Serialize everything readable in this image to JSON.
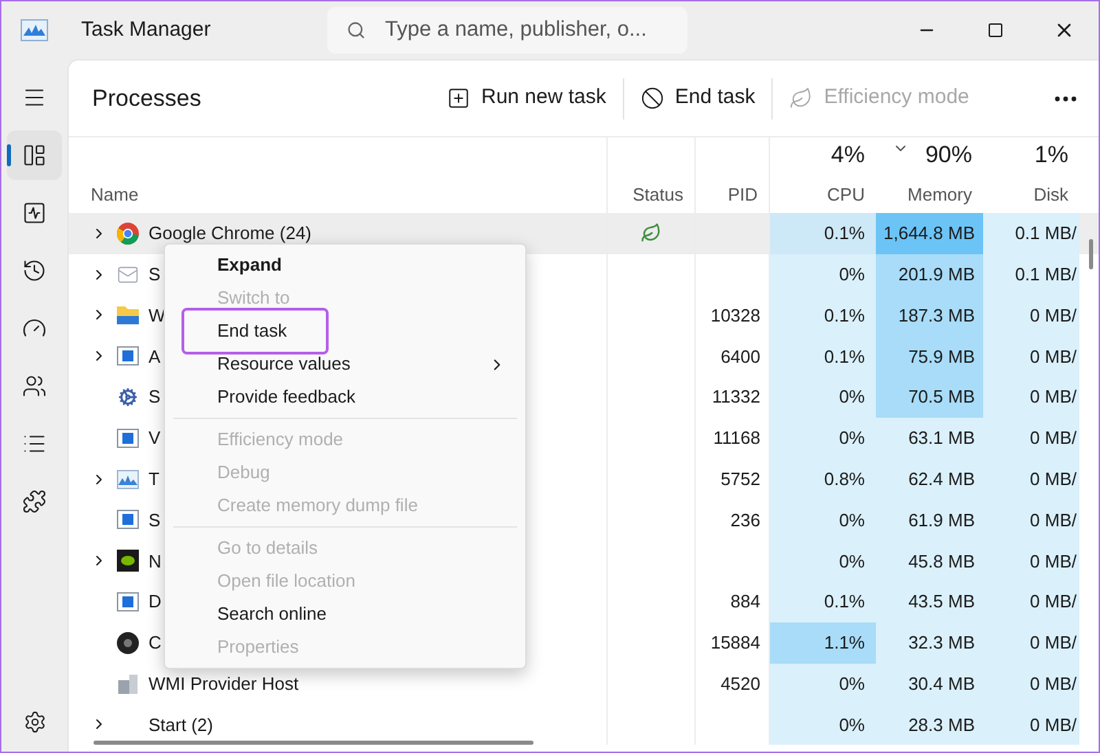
{
  "window": {
    "title": "Task Manager"
  },
  "search": {
    "placeholder": "Type a name, publisher, o..."
  },
  "sidebar": {
    "items": [
      {
        "selected": false
      },
      {
        "selected": true
      },
      {
        "selected": false
      },
      {
        "selected": false
      },
      {
        "selected": false
      },
      {
        "selected": false
      },
      {
        "selected": false
      },
      {
        "selected": false
      }
    ]
  },
  "page": {
    "title": "Processes",
    "actions": [
      {
        "label": "Run new task",
        "disabled": false
      },
      {
        "label": "End task",
        "disabled": false
      },
      {
        "label": "Efficiency mode",
        "disabled": true
      }
    ]
  },
  "table": {
    "columns": [
      {
        "label": "Name",
        "sorted": false
      },
      {
        "label": "Status",
        "sorted": false
      },
      {
        "label": "PID",
        "sorted": false
      },
      {
        "label": "CPU",
        "total": "4%",
        "sorted": false
      },
      {
        "label": "Memory",
        "total": "90%",
        "sorted": true
      },
      {
        "label": "Disk",
        "total": "1%",
        "sorted": false
      }
    ],
    "rows": [
      {
        "expandable": true,
        "name": "Google Chrome (24)",
        "efficiency": true,
        "hovered": true,
        "pid": "",
        "cpu": {
          "value": "0.1%",
          "color": "#cde8f6"
        },
        "memory": {
          "value": "1,644.8 MB",
          "color": "#6cc4f6"
        },
        "disk": "0.1 MB/"
      },
      {
        "expandable": true,
        "name": "S",
        "efficiency": false,
        "hovered": false,
        "pid": "",
        "cpu": {
          "value": "0%",
          "color": "#daf0fb"
        },
        "memory": {
          "value": "201.9 MB",
          "color": "#a8dcf8"
        },
        "disk": "0.1 MB/"
      },
      {
        "expandable": true,
        "name": "W",
        "efficiency": false,
        "hovered": false,
        "pid": "10328",
        "cpu": {
          "value": "0.1%",
          "color": "#daf0fb"
        },
        "memory": {
          "value": "187.3 MB",
          "color": "#a8dcf8"
        },
        "disk": "0 MB/"
      },
      {
        "expandable": true,
        "name": "A",
        "efficiency": false,
        "hovered": false,
        "pid": "6400",
        "cpu": {
          "value": "0.1%",
          "color": "#daf0fb"
        },
        "memory": {
          "value": "75.9 MB",
          "color": "#a8dcf8"
        },
        "disk": "0 MB/"
      },
      {
        "expandable": false,
        "name": "S",
        "efficiency": false,
        "hovered": false,
        "pid": "11332",
        "cpu": {
          "value": "0%",
          "color": "#daf0fb"
        },
        "memory": {
          "value": "70.5 MB",
          "color": "#a8dcf8"
        },
        "disk": "0 MB/"
      },
      {
        "expandable": false,
        "name": "V",
        "efficiency": false,
        "hovered": false,
        "pid": "11168",
        "cpu": {
          "value": "0%",
          "color": "#daf0fb"
        },
        "memory": {
          "value": "63.1 MB",
          "color": "#daf0fb"
        },
        "disk": "0 MB/"
      },
      {
        "expandable": true,
        "name": "T",
        "efficiency": false,
        "hovered": false,
        "pid": "5752",
        "cpu": {
          "value": "0.8%",
          "color": "#daf0fb"
        },
        "memory": {
          "value": "62.4 MB",
          "color": "#daf0fb"
        },
        "disk": "0 MB/"
      },
      {
        "expandable": false,
        "name": "S",
        "efficiency": false,
        "hovered": false,
        "pid": "236",
        "cpu": {
          "value": "0%",
          "color": "#daf0fb"
        },
        "memory": {
          "value": "61.9 MB",
          "color": "#daf0fb"
        },
        "disk": "0 MB/"
      },
      {
        "expandable": true,
        "name": "N",
        "efficiency": false,
        "hovered": false,
        "pid": "",
        "cpu": {
          "value": "0%",
          "color": "#daf0fb"
        },
        "memory": {
          "value": "45.8 MB",
          "color": "#daf0fb"
        },
        "disk": "0 MB/"
      },
      {
        "expandable": false,
        "name": "D",
        "efficiency": false,
        "hovered": false,
        "pid": "884",
        "cpu": {
          "value": "0.1%",
          "color": "#daf0fb"
        },
        "memory": {
          "value": "43.5 MB",
          "color": "#daf0fb"
        },
        "disk": "0 MB/"
      },
      {
        "expandable": false,
        "name": "C",
        "efficiency": false,
        "hovered": false,
        "pid": "15884",
        "cpu": {
          "value": "1.1%",
          "color": "#a8dcf8"
        },
        "memory": {
          "value": "32.3 MB",
          "color": "#daf0fb"
        },
        "disk": "0 MB/"
      },
      {
        "expandable": false,
        "name": "WMI Provider Host",
        "efficiency": false,
        "hovered": false,
        "pid": "4520",
        "cpu": {
          "value": "0%",
          "color": "#daf0fb"
        },
        "memory": {
          "value": "30.4 MB",
          "color": "#daf0fb"
        },
        "disk": "0 MB/"
      },
      {
        "expandable": true,
        "name": "Start (2)",
        "efficiency": false,
        "hovered": false,
        "pid": "",
        "cpu": {
          "value": "0%",
          "color": "#daf0fb"
        },
        "memory": {
          "value": "28.3 MB",
          "color": "#daf0fb"
        },
        "disk": "0 MB/"
      }
    ]
  },
  "context_menu": {
    "groups": [
      [
        {
          "label": "Expand",
          "default": true,
          "disabled": false,
          "submenu": false,
          "highlighted": false
        },
        {
          "label": "Switch to",
          "default": false,
          "disabled": true,
          "submenu": false,
          "highlighted": false
        },
        {
          "label": "End task",
          "default": false,
          "disabled": false,
          "submenu": false,
          "highlighted": true
        },
        {
          "label": "Resource values",
          "default": false,
          "disabled": false,
          "submenu": true,
          "highlighted": false
        },
        {
          "label": "Provide feedback",
          "default": false,
          "disabled": false,
          "submenu": false,
          "highlighted": false
        }
      ],
      [
        {
          "label": "Efficiency mode",
          "default": false,
          "disabled": true,
          "submenu": false,
          "highlighted": false
        },
        {
          "label": "Debug",
          "default": false,
          "disabled": true,
          "submenu": false,
          "highlighted": false
        },
        {
          "label": "Create memory dump file",
          "default": false,
          "disabled": true,
          "submenu": false,
          "highlighted": false
        }
      ],
      [
        {
          "label": "Go to details",
          "default": false,
          "disabled": true,
          "submenu": false,
          "highlighted": false
        },
        {
          "label": "Open file location",
          "default": false,
          "disabled": true,
          "submenu": false,
          "highlighted": false
        },
        {
          "label": "Search online",
          "default": false,
          "disabled": false,
          "submenu": false,
          "highlighted": false
        },
        {
          "label": "Properties",
          "default": false,
          "disabled": true,
          "submenu": false,
          "highlighted": false
        }
      ]
    ]
  }
}
